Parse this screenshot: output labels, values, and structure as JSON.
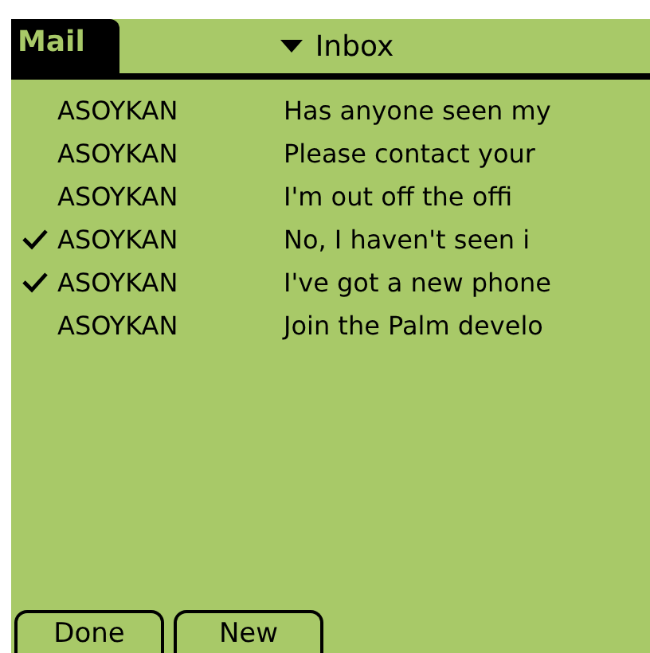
{
  "app_title": "Mail",
  "folder": {
    "label": "Inbox"
  },
  "messages": [
    {
      "sender": "ASOYKAN",
      "subject": "Has anyone seen my",
      "checked": false
    },
    {
      "sender": "ASOYKAN",
      "subject": "Please contact your",
      "checked": false
    },
    {
      "sender": "ASOYKAN",
      "subject": "I'm out off the offi",
      "checked": false
    },
    {
      "sender": "ASOYKAN",
      "subject": "No, I haven't seen i",
      "checked": true
    },
    {
      "sender": "ASOYKAN",
      "subject": "I've got a new phone",
      "checked": true
    },
    {
      "sender": "ASOYKAN",
      "subject": "Join the Palm develo",
      "checked": false
    }
  ],
  "buttons": [
    "Done",
    "New"
  ]
}
